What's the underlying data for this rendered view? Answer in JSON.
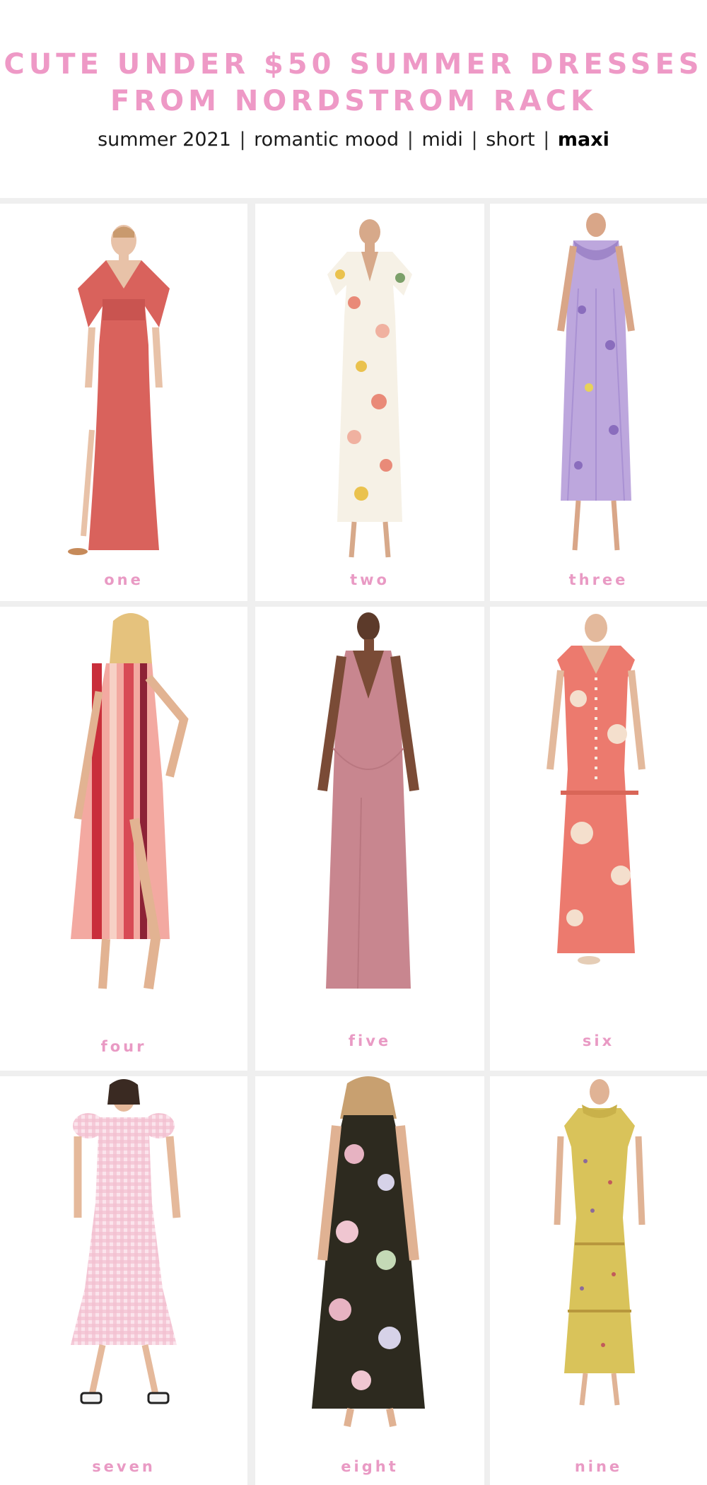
{
  "header": {
    "title_line1": "CUTE UNDER $50 SUMMER DRESSES",
    "title_line2": "FROM NORDSTROM RACK",
    "nav": [
      {
        "label": "summer 2021",
        "active": false
      },
      {
        "label": "romantic mood",
        "active": false
      },
      {
        "label": "midi",
        "active": false
      },
      {
        "label": "short",
        "active": false
      },
      {
        "label": "maxi",
        "active": true
      }
    ],
    "separator": "|"
  },
  "products": [
    {
      "label": "one",
      "dress": "coral maxi dress with kimono sleeves and side slit"
    },
    {
      "label": "two",
      "dress": "white floral maxi dress with flutter sleeves"
    },
    {
      "label": "three",
      "dress": "lavender floral pleated ruffle dress"
    },
    {
      "label": "four",
      "dress": "red and pink vertical stripe maxi dress"
    },
    {
      "label": "five",
      "dress": "dusty rose v-neck maxi slip dress"
    },
    {
      "label": "six",
      "dress": "coral floral tiered button-front maxi dress"
    },
    {
      "label": "seven",
      "dress": "pink gingham puff sleeve tiered dress"
    },
    {
      "label": "eight",
      "dress": "black tropical floral halter maxi dress"
    },
    {
      "label": "nine",
      "dress": "yellow ditsy floral ruffle maxi dress"
    }
  ],
  "colors": {
    "accent_pink": "#ee99c6",
    "label_pink": "#e99ac4",
    "grid_bg": "#efefef"
  }
}
